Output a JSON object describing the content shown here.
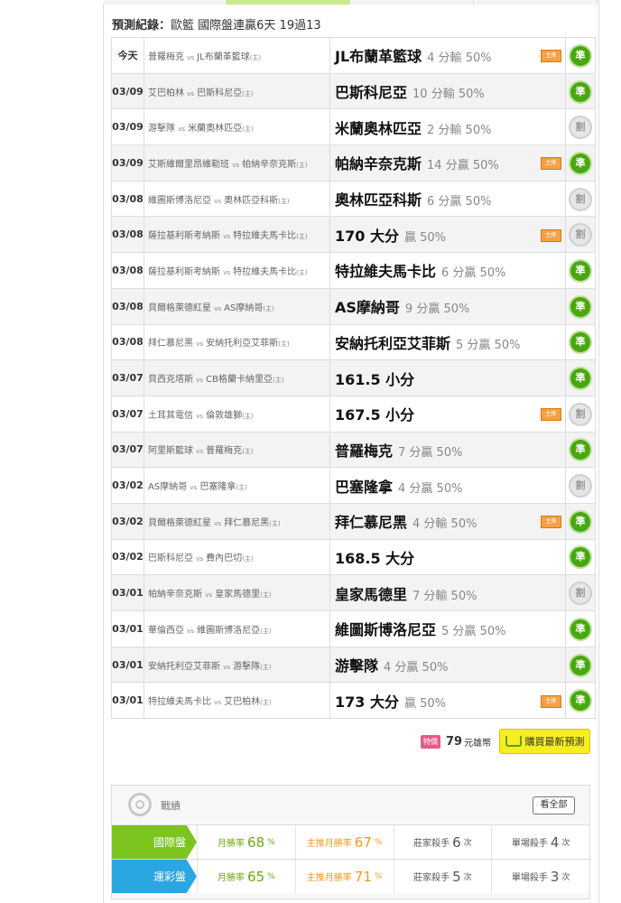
{
  "header": {
    "label": "預測紀錄：",
    "summary": "歐籃 國際盤連贏6天 19過13"
  },
  "records": [
    {
      "date": "今天",
      "away": "普羅梅克",
      "home": "JL布蘭革籃球",
      "pick": "JL布蘭革籃球",
      "detail": "4 分輸 50%",
      "tag": true,
      "result": "win",
      "result_text": "準"
    },
    {
      "date": "03/09",
      "away": "艾巴柏林",
      "home": "巴斯科尼亞",
      "pick": "巴斯科尼亞",
      "detail": "10 分輸 50%",
      "tag": false,
      "result": "win",
      "result_text": "準"
    },
    {
      "date": "03/09",
      "away": "游擊隊",
      "home": "米蘭奧林匹亞",
      "pick": "米蘭奧林匹亞",
      "detail": "2 分輸 50%",
      "tag": false,
      "result": "draw",
      "result_text": "割"
    },
    {
      "date": "03/09",
      "away": "艾斯維爾里昂維勒班",
      "home": "帕納辛奈克斯",
      "pick": "帕納辛奈克斯",
      "detail": "14 分贏 50%",
      "tag": true,
      "result": "win",
      "result_text": "準"
    },
    {
      "date": "03/08",
      "away": "維圖斯博洛尼亞",
      "home": "奧林匹亞科斯",
      "pick": "奧林匹亞科斯",
      "detail": "6 分贏 50%",
      "tag": false,
      "result": "draw",
      "result_text": "割"
    },
    {
      "date": "03/08",
      "away": "薩拉基利斯考納斯",
      "home": "特拉維夫馬卡比",
      "pick": "170 大分",
      "detail": "贏 50%",
      "tag": true,
      "result": "draw",
      "result_text": "割"
    },
    {
      "date": "03/08",
      "away": "薩拉基利斯考納斯",
      "home": "特拉維夫馬卡比",
      "pick": "特拉維夫馬卡比",
      "detail": "6 分贏 50%",
      "tag": false,
      "result": "win",
      "result_text": "準"
    },
    {
      "date": "03/08",
      "away": "貝爾格萊德紅星",
      "home": "AS摩納哥",
      "pick": "AS摩納哥",
      "detail": "9 分贏 50%",
      "tag": false,
      "result": "win",
      "result_text": "準"
    },
    {
      "date": "03/08",
      "away": "拜仁慕尼黑",
      "home": "安納托利亞艾菲斯",
      "pick": "安納托利亞艾菲斯",
      "detail": "5 分贏 50%",
      "tag": false,
      "result": "win",
      "result_text": "準"
    },
    {
      "date": "03/07",
      "away": "貝西克塔斯",
      "home": "CB格蘭卡納里亞",
      "pick": "161.5 小分",
      "detail": "",
      "tag": false,
      "result": "win",
      "result_text": "準"
    },
    {
      "date": "03/07",
      "away": "土耳其電信",
      "home": "倫敦雄獅",
      "pick": "167.5 小分",
      "detail": "",
      "tag": true,
      "result": "draw",
      "result_text": "割"
    },
    {
      "date": "03/07",
      "away": "阿里斯籃球",
      "home": "普羅梅克",
      "pick": "普羅梅克",
      "detail": "7 分贏 50%",
      "tag": false,
      "result": "win",
      "result_text": "準"
    },
    {
      "date": "03/02",
      "away": "AS摩納哥",
      "home": "巴塞隆拿",
      "pick": "巴塞隆拿",
      "detail": "4 分贏 50%",
      "tag": false,
      "result": "draw",
      "result_text": "割"
    },
    {
      "date": "03/02",
      "away": "貝爾格萊德紅星",
      "home": "拜仁慕尼黑",
      "pick": "拜仁慕尼黑",
      "detail": "4 分輸 50%",
      "tag": true,
      "result": "win",
      "result_text": "準"
    },
    {
      "date": "03/02",
      "away": "巴斯科尼亞",
      "home": "費內巴切",
      "pick": "168.5 大分",
      "detail": "",
      "tag": false,
      "result": "win",
      "result_text": "準"
    },
    {
      "date": "03/01",
      "away": "帕納辛奈克斯",
      "home": "皇家馬德里",
      "pick": "皇家馬德里",
      "detail": "7 分輸 50%",
      "tag": false,
      "result": "draw",
      "result_text": "割"
    },
    {
      "date": "03/01",
      "away": "華倫西亞",
      "home": "維圖斯博洛尼亞",
      "pick": "維圖斯博洛尼亞",
      "detail": "5 分贏 50%",
      "tag": false,
      "result": "win",
      "result_text": "準"
    },
    {
      "date": "03/01",
      "away": "安納托利亞艾菲斯",
      "home": "游擊隊",
      "pick": "游擊隊",
      "detail": "4 分贏 50%",
      "tag": false,
      "result": "win",
      "result_text": "準"
    },
    {
      "date": "03/01",
      "away": "特拉維夫馬卡比",
      "home": "艾巴柏林",
      "pick": "173 大分",
      "detail": "贏 50%",
      "tag": true,
      "result": "win",
      "result_text": "準"
    }
  ],
  "labels": {
    "vs": "vs",
    "home_mark": "(主)",
    "tag_text": "主推"
  },
  "purchase": {
    "sale_label": "特價",
    "price": "79",
    "unit": "元雄幣",
    "button_label": "購買最新預測"
  },
  "stats": {
    "title": "戰績",
    "see_all": "看全部",
    "rows": [
      {
        "label": "國際盤",
        "color": "#7cc41f",
        "month_rate": "68",
        "main_month_rate": "67",
        "house_kill": "6",
        "single_kill": "4"
      },
      {
        "label": "運彩盤",
        "color": "#2aa7e0",
        "month_rate": "65",
        "main_month_rate": "71",
        "house_kill": "5",
        "single_kill": "3"
      }
    ],
    "col_labels": {
      "month_rate": "月勝率",
      "main_month_rate": "主推月勝率",
      "house_kill": "莊家殺手",
      "single_kill": "單場殺手",
      "pct": "%",
      "times": "次"
    }
  }
}
